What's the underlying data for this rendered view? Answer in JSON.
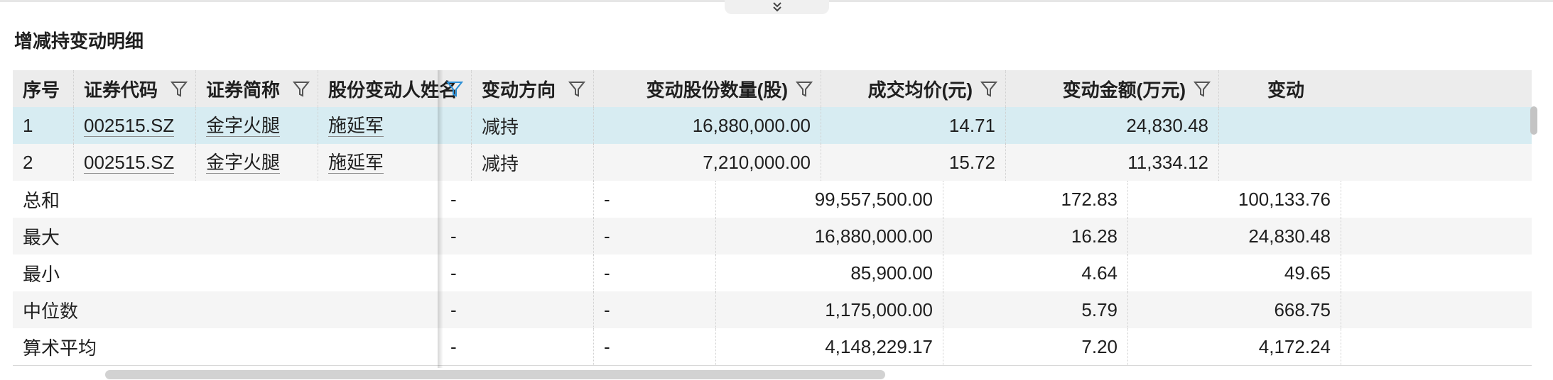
{
  "section_title": "增减持变动明细",
  "columns": [
    {
      "key": "seq",
      "label": "序号",
      "filter": false,
      "align": "left"
    },
    {
      "key": "code",
      "label": "证券代码",
      "filter": true,
      "align": "left"
    },
    {
      "key": "short_name",
      "label": "证券简称",
      "filter": true,
      "align": "left"
    },
    {
      "key": "holder",
      "label": "股份变动人姓名",
      "filter": true,
      "filter_active": true,
      "align": "left"
    },
    {
      "key": "direction",
      "label": "变动方向",
      "filter": true,
      "align": "left"
    },
    {
      "key": "shares",
      "label": "变动股份数量(股)",
      "filter": true,
      "align": "right"
    },
    {
      "key": "price",
      "label": "成交均价(元)",
      "filter": true,
      "align": "right"
    },
    {
      "key": "amount",
      "label": "变动金额(万元)",
      "filter": true,
      "align": "right"
    },
    {
      "key": "more",
      "label": "变动",
      "filter": false,
      "align": "right"
    }
  ],
  "rows": [
    {
      "seq": "1",
      "code": "002515.SZ",
      "short_name": "金字火腿",
      "holder": "施延军",
      "direction": "减持",
      "shares": "16,880,000.00",
      "price": "14.71",
      "amount": "24,830.48",
      "selected": true
    },
    {
      "seq": "2",
      "code": "002515.SZ",
      "short_name": "金字火腿",
      "holder": "施延军",
      "direction": "减持",
      "shares": "7,210,000.00",
      "price": "15.72",
      "amount": "11,334.12"
    }
  ],
  "summary": [
    {
      "label": "总和",
      "holder": "-",
      "direction": "-",
      "shares": "99,557,500.00",
      "price": "172.83",
      "amount": "100,133.76"
    },
    {
      "label": "最大",
      "holder": "-",
      "direction": "-",
      "shares": "16,880,000.00",
      "price": "16.28",
      "amount": "24,830.48"
    },
    {
      "label": "最小",
      "holder": "-",
      "direction": "-",
      "shares": "85,900.00",
      "price": "4.64",
      "amount": "49.65"
    },
    {
      "label": "中位数",
      "holder": "-",
      "direction": "-",
      "shares": "1,175,000.00",
      "price": "5.79",
      "amount": "668.75"
    },
    {
      "label": "算术平均",
      "holder": "-",
      "direction": "-",
      "shares": "4,148,229.17",
      "price": "7.20",
      "amount": "4,172.24"
    }
  ],
  "colors": {
    "filter_icon": "#555555",
    "filter_icon_active": "#2b8fd6",
    "selected_row": "#d7ecf2",
    "header_bg": "#ececec"
  }
}
